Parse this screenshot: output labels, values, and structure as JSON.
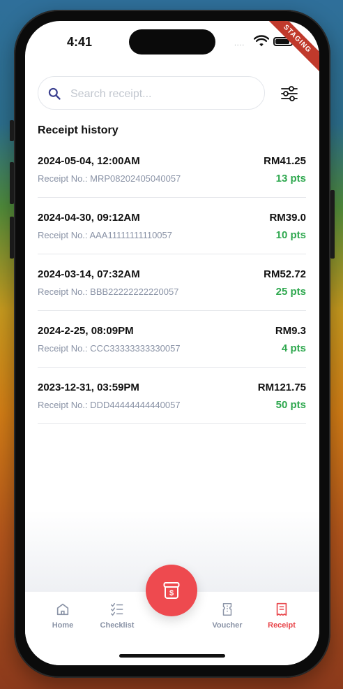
{
  "status_bar": {
    "time": "4:41",
    "signal": "....",
    "badge": "STAGING"
  },
  "search": {
    "placeholder": "Search receipt..."
  },
  "section_title": "Receipt history",
  "receipts": [
    {
      "date": "2024-05-04, 12:00AM",
      "receipt_label": "Receipt No.:",
      "receipt_no": "MRP08202405040057",
      "amount": "RM41.25",
      "points": "13 pts"
    },
    {
      "date": "2024-04-30, 09:12AM",
      "receipt_label": "Receipt No.:",
      "receipt_no": "AAA11111111110057",
      "amount": "RM39.0",
      "points": "10 pts"
    },
    {
      "date": "2024-03-14, 07:32AM",
      "receipt_label": "Receipt No.:",
      "receipt_no": "BBB22222222220057",
      "amount": "RM52.72",
      "points": "25 pts"
    },
    {
      "date": "2024-2-25, 08:09PM",
      "receipt_label": "Receipt No.:",
      "receipt_no": "CCC33333333330057",
      "amount": "RM9.3",
      "points": "4 pts"
    },
    {
      "date": "2023-12-31, 03:59PM",
      "receipt_label": "Receipt No.:",
      "receipt_no": "DDD44444444440057",
      "amount": "RM121.75",
      "points": "50 pts"
    }
  ],
  "nav": {
    "home": "Home",
    "checklist": "Checklist",
    "voucher": "Voucher",
    "receipt": "Receipt",
    "active": "receipt"
  },
  "colors": {
    "accent": "#ee4a4f",
    "points_green": "#2fa84f",
    "muted": "#8a93a6",
    "search_icon": "#3a3f8f"
  },
  "icons": {
    "search": "search-icon",
    "filter": "filter-sliders-icon",
    "home": "home-icon",
    "checklist": "checklist-icon",
    "voucher": "voucher-icon",
    "receipt": "receipt-icon",
    "fab": "cashier-box-icon"
  }
}
